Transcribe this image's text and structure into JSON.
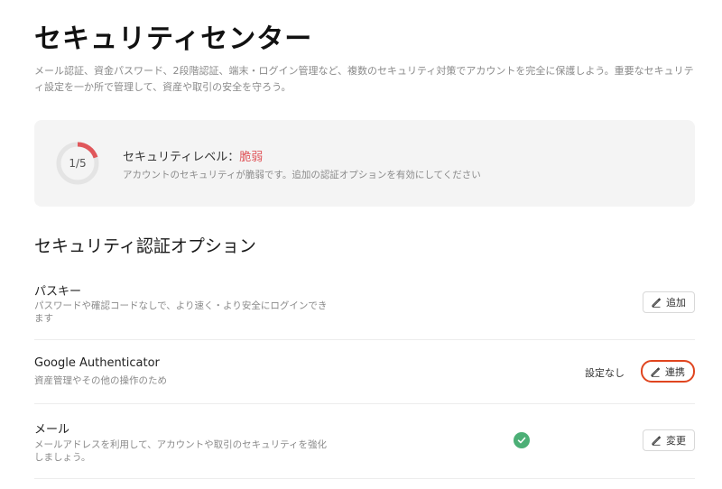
{
  "page": {
    "title": "セキュリティセンター",
    "description": "メール認証、資金パスワード、2段階認証、端末・ログイン管理など、複数のセキュリティ対策でアカウントを完全に保護しよう。重要なセキュリティ設定を一か所で管理して、資産や取引の安全を守ろう。"
  },
  "security_level": {
    "progress_text": "1/5",
    "progress_fraction": 0.2,
    "label": "セキュリティレベル：",
    "value": "脆弱",
    "hint": "アカウントのセキュリティが脆弱です。追加の認証オプションを有効にしてください",
    "accent_color": "#e0575b"
  },
  "options_section": {
    "title": "セキュリティ認証オプション",
    "items": [
      {
        "name": "パスキー",
        "description": "パスワードや確認コードなしで、より速く・より安全にログインできます",
        "status": "",
        "button_label": "追加",
        "button_icon": "pencil-icon"
      },
      {
        "name": "Google Authenticator",
        "description": "資産管理やその他の操作のため",
        "status": "設定なし",
        "button_label": "連携",
        "button_icon": "pencil-icon",
        "highlighted": true
      },
      {
        "name": "メール",
        "description": "メールアドレスを利用して、アカウントや取引のセキュリティを強化しましょう。",
        "status_icon": "check-circle-icon",
        "button_label": "変更",
        "button_icon": "pencil-icon"
      }
    ]
  },
  "colors": {
    "success": "#4caf76",
    "highlight_border": "#e0451f"
  }
}
